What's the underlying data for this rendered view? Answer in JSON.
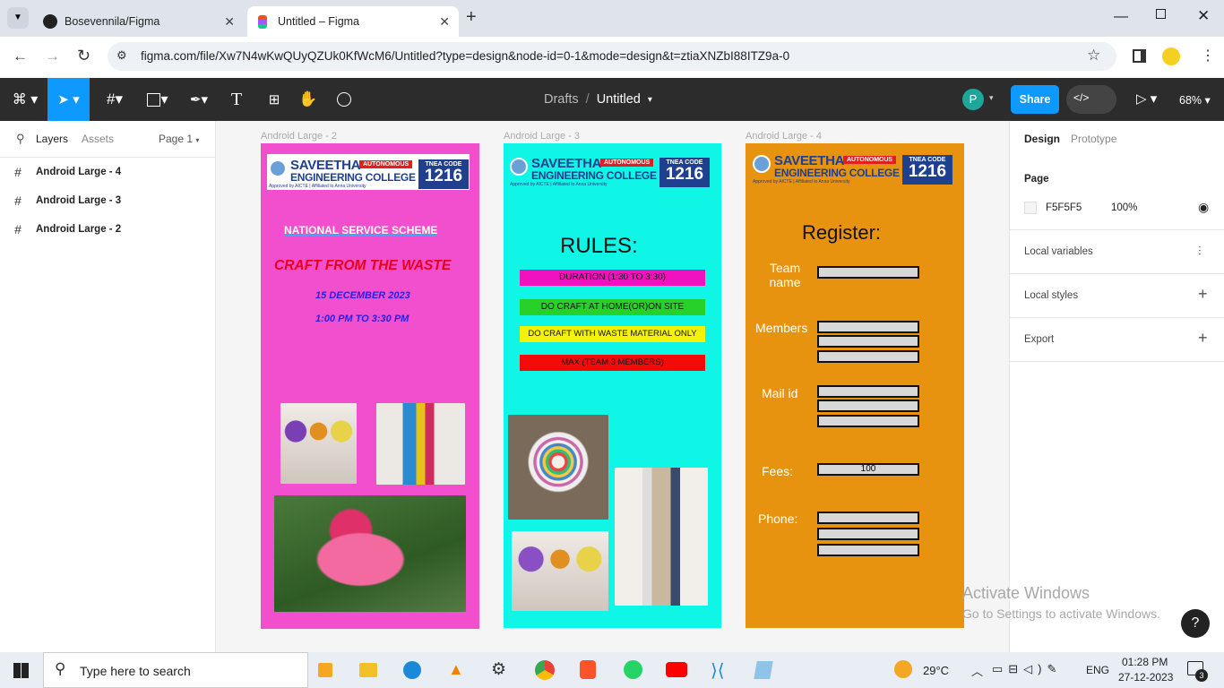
{
  "browser": {
    "tabs": [
      {
        "title": "Bosevennila/Figma",
        "icon": "github-icon"
      },
      {
        "title": "Untitled – Figma",
        "icon": "figma-icon"
      }
    ],
    "url": "figma.com/file/Xw7N4wKwQUyQZUk0KfWcM6/Untitled?type=design&node-id=0-1&mode=design&t=ztiaXNZbI88ITZ9a-0"
  },
  "toolbar": {
    "breadcrumb_parent": "Drafts",
    "separator": "/",
    "file_name": "Untitled",
    "avatar_letter": "P",
    "share_label": "Share",
    "zoom": "68%"
  },
  "left_panel": {
    "tab_layers": "Layers",
    "tab_assets": "Assets",
    "page": "Page 1",
    "layers": [
      "Android Large - 4",
      "Android Large - 3",
      "Android Large - 2"
    ]
  },
  "right_panel": {
    "tab_design": "Design",
    "tab_prototype": "Prototype",
    "page_heading": "Page",
    "page_color": "F5F5F5",
    "page_opacity": "100%",
    "local_variables": "Local variables",
    "local_styles": "Local styles",
    "export": "Export"
  },
  "frames": {
    "f2": {
      "label": "Android Large - 2",
      "nss": "NATIONAL SERVICE SCHEME",
      "title": "CRAFT FROM THE WASTE",
      "date": "15 DECEMBER 2023",
      "time": "1:00 PM TO 3:30 PM"
    },
    "f3": {
      "label": "Android Large - 3",
      "heading": "RULES:",
      "rules": [
        "DURATION (1:30 TO 3:30)",
        "DO CRAFT AT HOME(OR)ON SITE",
        "DO CRAFT WITH WASTE MATERIAL ONLY",
        "MAX (TEAM 3 MEMBERS)"
      ]
    },
    "f4": {
      "label": "Android Large - 4",
      "heading": "Register:",
      "team": "Team\nname",
      "members": "Members",
      "mail": "Mail id",
      "fees": "Fees:",
      "fees_value": "100",
      "phone": "Phone:"
    },
    "logo": {
      "name1": "SAVEETHA",
      "name2": "ENGINEERING COLLEGE",
      "autonomous": "AUTONOMOUS",
      "approved": "Approved by AICTE | Affiliated to Anna University",
      "tnea": "TNEA CODE",
      "code": "1216"
    }
  },
  "watermark": {
    "line1": "Activate Windows",
    "line2": "Go to Settings to activate Windows."
  },
  "help": "?",
  "taskbar": {
    "search_placeholder": "Type here to search",
    "temperature": "29°C",
    "language": "ENG",
    "time": "01:28 PM",
    "date": "27-12-2023",
    "notifications": "3"
  },
  "colors": {
    "f2_bg": "#f24fcf",
    "f3_bg": "#0ff5e6",
    "f4_bg": "#e8930f",
    "share": "#0d99ff",
    "toolbar": "#2c2c2c"
  }
}
